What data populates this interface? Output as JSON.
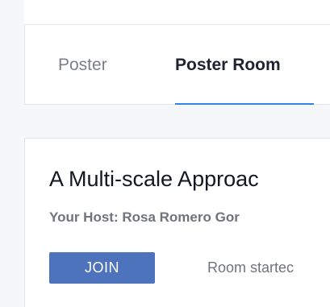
{
  "tabs": {
    "items": [
      {
        "label": "Poster"
      },
      {
        "label": "Poster Room"
      }
    ],
    "active": "Poster Room",
    "accent_color": "#2f86e8"
  },
  "room": {
    "title": "A Multi-scale Approac",
    "host": "Your Host: Rosa Romero Gor",
    "join_label": "JOIN",
    "join_color": "#4e73bd",
    "status": "Room startec"
  }
}
